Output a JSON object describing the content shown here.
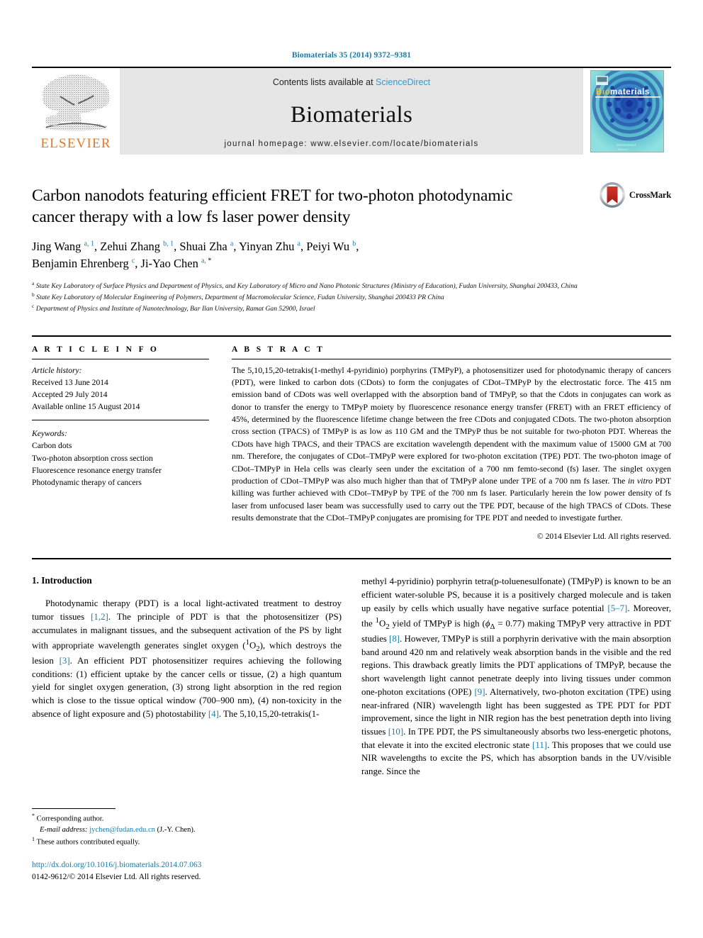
{
  "running_head": "Biomaterials 35 (2014) 9372–9381",
  "masthead": {
    "contents_prefix": "Contents lists available at ",
    "sciencedirect": "ScienceDirect",
    "journal_name": "Biomaterials",
    "homepage": "journal homepage: www.elsevier.com/locate/biomaterials",
    "publisher_wordmark": "ELSEVIER",
    "cover_title_bio": "Bio",
    "cover_title_rest": "materials",
    "accent_orange": "#E87722",
    "accent_blue": "#2e9bd6",
    "link_blue": "#1a7aa8"
  },
  "article": {
    "title": "Carbon nanodots featuring efficient FRET for two-photon photodynamic cancer therapy with a low fs laser power density",
    "crossmark_label": "CrossMark",
    "authors": [
      {
        "name": "Jing Wang",
        "sup": "a, 1",
        "sep": ", "
      },
      {
        "name": "Zehui Zhang",
        "sup": "b, 1",
        "sep": ", "
      },
      {
        "name": "Shuai Zha",
        "sup": "a",
        "sep": ", "
      },
      {
        "name": "Yinyan Zhu",
        "sup": "a",
        "sep": ", "
      },
      {
        "name": "Peiyi Wu",
        "sup": "b",
        "sep": ","
      },
      {
        "name": "Benjamin Ehrenberg",
        "sup": "c",
        "sep": ", "
      },
      {
        "name": "Ji-Yao Chen",
        "sup": "a, *",
        "sep": ""
      }
    ],
    "affiliations": [
      {
        "marker": "a",
        "text": "State Key Laboratory of Surface Physics and Department of Physics, and Key Laboratory of Micro and Nano Photonic Structures (Ministry of Education), Fudan University, Shanghai 200433, China"
      },
      {
        "marker": "b",
        "text": "State Key Laboratory of Molecular Engineering of Polymers, Department of Macromolecular Science, Fudan University, Shanghai 200433 PR China"
      },
      {
        "marker": "c",
        "text": "Department of Physics and Institute of Nanotechnology, Bar Ilan University, Ramat Gan 52900, Israel"
      }
    ]
  },
  "article_info": {
    "heading": "A R T I C L E  I N F O",
    "history_label": "Article history:",
    "history": [
      "Received 13 June 2014",
      "Accepted 29 July 2014",
      "Available online 15 August 2014"
    ],
    "keywords_label": "Keywords:",
    "keywords": [
      "Carbon dots",
      "Two-photon absorption cross section",
      "Fluorescence resonance energy transfer",
      "Photodynamic therapy of cancers"
    ]
  },
  "abstract": {
    "heading": "A B S T R A C T",
    "text": "The 5,10,15,20-tetrakis(1-methyl 4-pyridinio) porphyrins (TMPyP), a photosensitizer used for photodynamic therapy of cancers (PDT), were linked to carbon dots (CDots) to form the conjugates of CDot–TMPyP by the electrostatic force. The 415 nm emission band of CDots was well overlapped with the absorption band of TMPyP, so that the Cdots in conjugates can work as donor to transfer the energy to TMPyP moiety by fluorescence resonance energy transfer (FRET) with an FRET efficiency of 45%, determined by the fluorescence lifetime change between the free CDots and conjugated CDots. The two-photon absorption cross section (TPACS) of TMPyP is as low as 110 GM and the TMPyP thus be not suitable for two-photon PDT. Whereas the CDots have high TPACS, and their TPACS are excitation wavelength dependent with the maximum value of 15000 GM at 700 nm. Therefore, the conjugates of CDot–TMPyP were explored for two-photon excitation (TPE) PDT. The two-photon image of CDot–TMPyP in Hela cells was clearly seen under the excitation of a 700 nm femto-second (fs) laser. The singlet oxygen production of CDot–TMPyP was also much higher than that of TMPyP alone under TPE of a 700 nm fs laser. The in vitro PDT killing was further achieved with CDot–TMPyP by TPE of the 700 nm fs laser. Particularly herein the low power density of fs laser from unfocused laser beam was successfully used to carry out the TPE PDT, because of the high TPACS of CDots. These results demonstrate that the CDot–TMPyP conjugates are promising for TPE PDT and needed to investigate further.",
    "copyright": "© 2014 Elsevier Ltd. All rights reserved."
  },
  "introduction": {
    "heading": "1. Introduction",
    "left_paragraph": "Photodynamic therapy (PDT) is a local light-activated treatment to destroy tumor tissues [1,2]. The principle of PDT is that the photosensitizer (PS) accumulates in malignant tissues, and the subsequent activation of the PS by light with appropriate wavelength generates singlet oxygen (1O2), which destroys the lesion [3]. An efficient PDT photosensitizer requires achieving the following conditions: (1) efficient uptake by the cancer cells or tissue, (2) a high quantum yield for singlet oxygen generation, (3) strong light absorption in the red region which is close to the tissue optical window (700–900 nm), (4) non-toxicity in the absence of light exposure and (5) photostability [4]. The 5,10,15,20-tetrakis(1-",
    "right_paragraph": "methyl 4-pyridinio) porphyrin tetra(p-toluenesulfonate) (TMPyP) is known to be an efficient water-soluble PS, because it is a positively charged molecule and is taken up easily by cells which usually have negative surface potential [5–7]. Moreover, the 1O2 yield of TMPyP is high (ϕΔ = 0.77) making TMPyP very attractive in PDT studies [8]. However, TMPyP is still a porphyrin derivative with the main absorption band around 420 nm and relatively weak absorption bands in the visible and the red regions. This drawback greatly limits the PDT applications of TMPyP, because the short wavelength light cannot penetrate deeply into living tissues under common one-photon excitations (OPE) [9]. Alternatively, two-photon excitation (TPE) using near-infrared (NIR) wavelength light has been suggested as TPE PDT for PDT improvement, since the light in NIR region has the best penetration depth into living tissues [10]. In TPE PDT, the PS simultaneously absorbs two less-energetic photons, that elevate it into the excited electronic state [11]. This proposes that we could use NIR wavelengths to excite the PS, which has absorption bands in the UV/visible range. Since the"
  },
  "footnotes": {
    "corresponding_marker": "*",
    "corresponding_text": "Corresponding author.",
    "email_label": "E-mail address:",
    "email": "jychen@fudan.edu.cn",
    "email_owner": "(J.-Y. Chen).",
    "equal_marker": "1",
    "equal_text": "These authors contributed equally."
  },
  "footer": {
    "doi": "http://dx.doi.org/10.1016/j.biomaterials.2014.07.063",
    "issn_copyright": "0142-9612/© 2014 Elsevier Ltd. All rights reserved."
  }
}
